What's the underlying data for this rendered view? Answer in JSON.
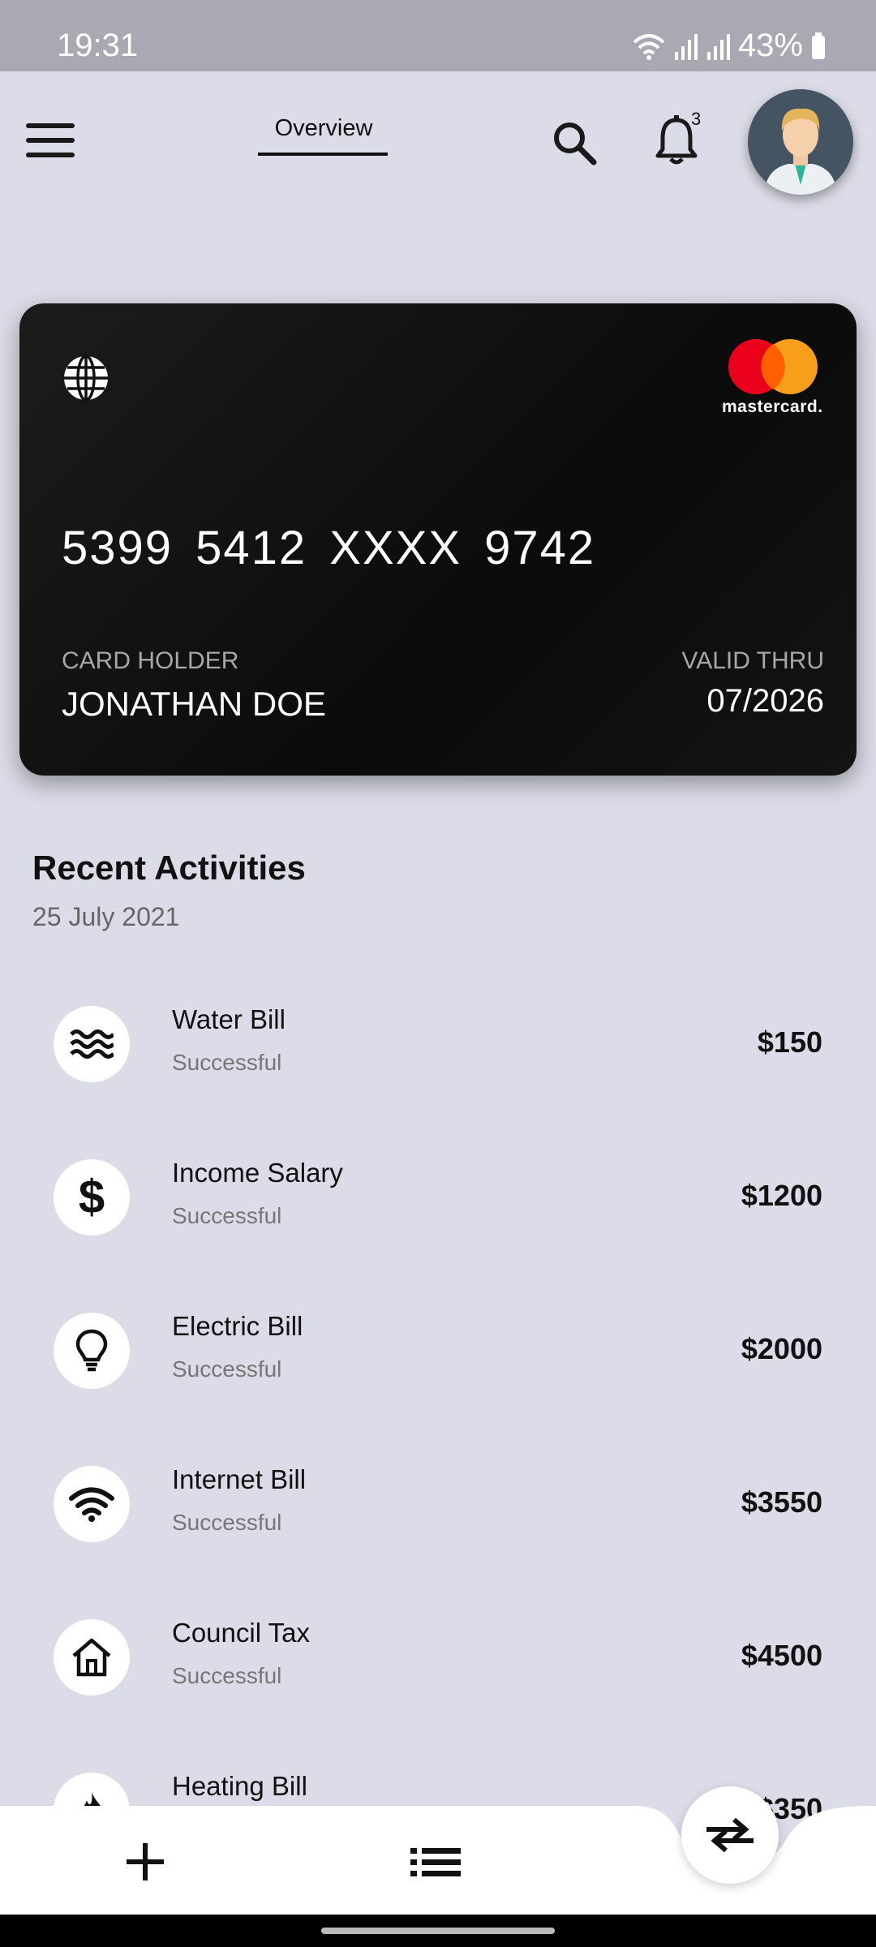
{
  "status_bar": {
    "time": "19:31",
    "battery": "43%"
  },
  "header": {
    "tab_label": "Overview",
    "notification_count": "3"
  },
  "card": {
    "number": "5399  5412  XXXX  9742",
    "holder_label": "CARD HOLDER",
    "holder_name": "JONATHAN DOE",
    "valid_label": "VALID THRU",
    "valid_date": "07/2026",
    "brand": "mastercard."
  },
  "recent": {
    "title": "Recent Activities",
    "date": "25 July 2021",
    "items": [
      {
        "name": "Water Bill",
        "status": "Successful",
        "amount": "$150",
        "icon": "water-waves-icon"
      },
      {
        "name": "Income Salary",
        "status": "Successful",
        "amount": "$1200",
        "icon": "dollar-icon"
      },
      {
        "name": "Electric Bill",
        "status": "Successful",
        "amount": "$2000",
        "icon": "lightbulb-icon"
      },
      {
        "name": "Internet Bill",
        "status": "Successful",
        "amount": "$3550",
        "icon": "wifi-icon"
      },
      {
        "name": "Council Tax",
        "status": "Successful",
        "amount": "$4500",
        "icon": "house-icon"
      },
      {
        "name": "Heating Bill",
        "status": "",
        "amount": "$350",
        "icon": "flame-icon"
      }
    ]
  },
  "colors": {
    "background": "#dcdce8",
    "card": "#111111",
    "mastercard_red": "#eb001b",
    "mastercard_orange": "#f79e1b"
  }
}
